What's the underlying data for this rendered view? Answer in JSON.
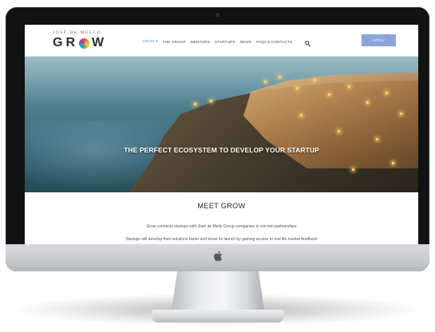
{
  "brand": {
    "tagline": "JOSÉ DE MELLO",
    "wordmark": "GROW",
    "wordmark_letters": [
      "G",
      "R",
      "W"
    ],
    "logo_o": "rainbow-ring-icon"
  },
  "nav": {
    "items": [
      {
        "label": "GROW ▾",
        "active": true
      },
      {
        "label": "THE GROUP",
        "active": false
      },
      {
        "label": "MENTORS",
        "active": false
      },
      {
        "label": "STARTUPS",
        "active": false
      },
      {
        "label": "NEWS",
        "active": false
      },
      {
        "label": "FAQs & CONTACTS",
        "active": false
      }
    ],
    "search_icon": "search-icon",
    "apply_label": "APPLY"
  },
  "hero": {
    "headline": "THE PERFECT ECOSYSTEM TO DEVELOP YOUR STARTUP"
  },
  "section": {
    "title": "MEET GROW",
    "line1": "Grow connects startups with José de Mello Group companies in win-win partnerships",
    "line2": "Startups will develop their solutions faster and boost its launch by gaining access to real life market feedback"
  },
  "device": {
    "logo": "apple-logo-icon",
    "camera": "camera-icon"
  },
  "colors": {
    "accent": "#4a90d9",
    "apply_button": "#8aa5d8",
    "bezel": "#111214"
  }
}
